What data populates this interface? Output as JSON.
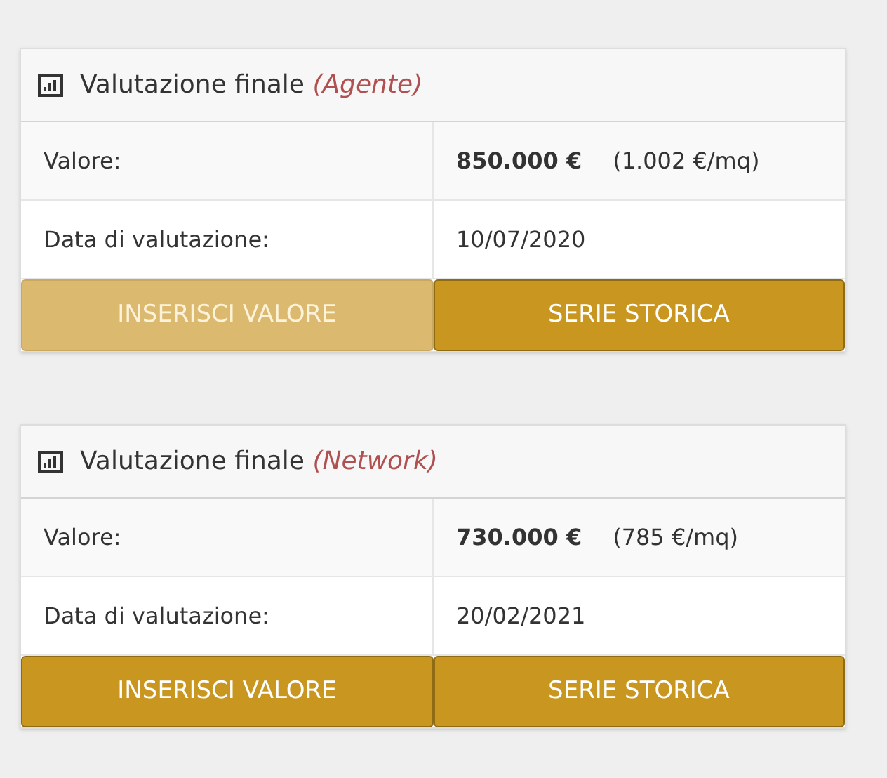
{
  "cards": [
    {
      "title": "Valutazione finale",
      "source": "(Agente)",
      "rows": [
        {
          "label": "Valore:",
          "value": "850.000 €",
          "note": "(1.002 €/mq)",
          "bold": true
        },
        {
          "label": "Data di valutazione:",
          "value": "10/07/2020",
          "bold": false
        }
      ],
      "buttons": [
        {
          "label": "INSERISCI VALORE",
          "disabled": true
        },
        {
          "label": "SERIE STORICA",
          "disabled": false
        }
      ]
    },
    {
      "title": "Valutazione finale",
      "source": "(Network)",
      "rows": [
        {
          "label": "Valore:",
          "value": "730.000 €",
          "note": "(785 €/mq)",
          "bold": true
        },
        {
          "label": "Data di valutazione:",
          "value": "20/02/2021",
          "bold": false
        }
      ],
      "buttons": [
        {
          "label": "INSERISCI VALORE",
          "disabled": false
        },
        {
          "label": "SERIE STORICA",
          "disabled": false
        }
      ]
    }
  ]
}
